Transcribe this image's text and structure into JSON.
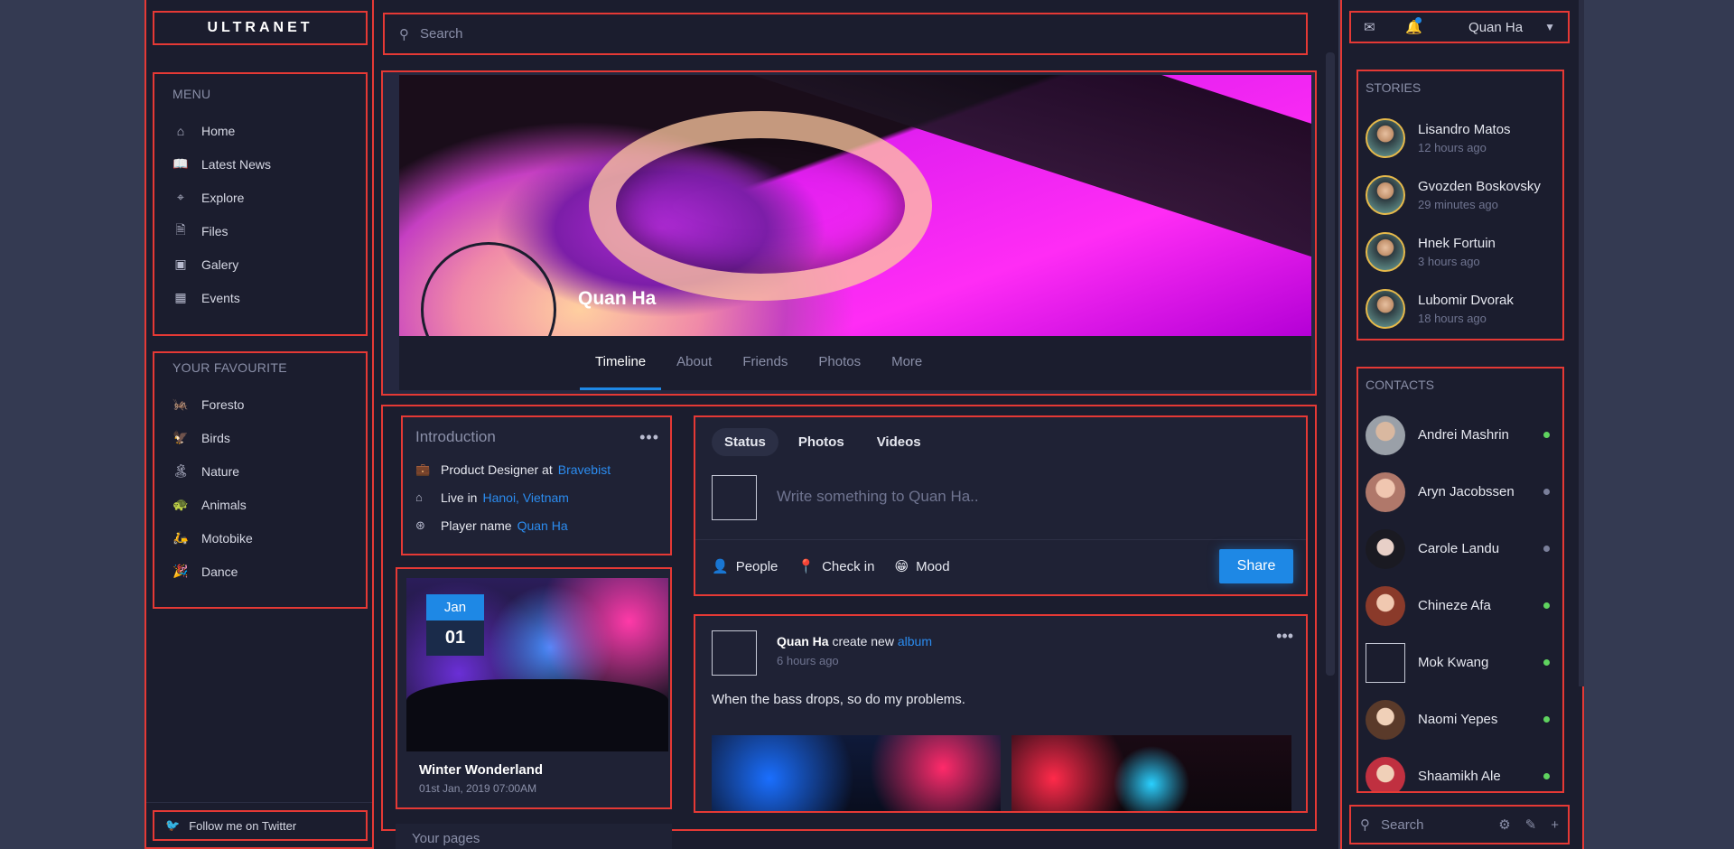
{
  "brand": "ULTRANET",
  "menu": {
    "heading": "MENU",
    "items": [
      {
        "label": "Home",
        "icon": "home-icon"
      },
      {
        "label": "Latest News",
        "icon": "book-icon"
      },
      {
        "label": "Explore",
        "icon": "map-pin-icon"
      },
      {
        "label": "Files",
        "icon": "file-icon"
      },
      {
        "label": "Galery",
        "icon": "image-icon"
      },
      {
        "label": "Events",
        "icon": "calendar-icon"
      }
    ]
  },
  "favourite": {
    "heading": "YOUR FAVOURITE",
    "items": [
      {
        "label": "Foresto",
        "icon": "🦗"
      },
      {
        "label": "Birds",
        "icon": "🦅"
      },
      {
        "label": "Nature",
        "icon": "🏝"
      },
      {
        "label": "Animals",
        "icon": "🐢"
      },
      {
        "label": "Motobike",
        "icon": "🛵"
      },
      {
        "label": "Dance",
        "icon": "🎉"
      }
    ]
  },
  "twitter": "Follow me on Twitter",
  "search": {
    "placeholder": "Search"
  },
  "profile": {
    "name": "Quan Ha",
    "tabs": [
      "Timeline",
      "About",
      "Friends",
      "Photos",
      "More"
    ],
    "active_tab": "Timeline"
  },
  "introduction": {
    "title": "Introduction",
    "rows": [
      {
        "label": "Product Designer at",
        "link": "Bravebist"
      },
      {
        "label": "Live in",
        "link": "Hanoi, Vietnam"
      },
      {
        "label": "Player name",
        "link": "Quan Ha"
      }
    ]
  },
  "event": {
    "month": "Jan",
    "day": "01",
    "title": "Winter Wonderland",
    "when": "01st Jan, 2019 07:00AM"
  },
  "your_pages": "Your pages",
  "composer": {
    "tabs": [
      "Status",
      "Photos",
      "Videos"
    ],
    "placeholder": "Write something to Quan Ha..",
    "actions": [
      {
        "label": "People",
        "icon": "👤"
      },
      {
        "label": "Check in",
        "icon": "📍"
      },
      {
        "label": "Mood",
        "icon": "😁"
      }
    ],
    "share": "Share"
  },
  "post": {
    "author": "Quan Ha",
    "action": "create new",
    "link": "album",
    "time": "6 hours ago",
    "text": "When the bass drops, so do my problems."
  },
  "user": {
    "name": "Quan Ha"
  },
  "stories": {
    "heading": "STORIES",
    "items": [
      {
        "name": "Lisandro Matos",
        "time": "12 hours ago"
      },
      {
        "name": "Gvozden Boskovsky",
        "time": "29 minutes ago"
      },
      {
        "name": "Hnek Fortuin",
        "time": "3 hours ago"
      },
      {
        "name": "Lubomir Dvorak",
        "time": "18 hours ago"
      }
    ]
  },
  "contacts": {
    "heading": "CONTACTS",
    "items": [
      {
        "name": "Andrei Mashrin",
        "status": "online"
      },
      {
        "name": "Aryn Jacobssen",
        "status": "offline"
      },
      {
        "name": "Carole Landu",
        "status": "offline"
      },
      {
        "name": "Chineze Afa",
        "status": "online"
      },
      {
        "name": "Mok Kwang",
        "status": "online"
      },
      {
        "name": "Naomi Yepes",
        "status": "online"
      },
      {
        "name": "Shaamikh Ale",
        "status": "online"
      }
    ]
  },
  "right_search": {
    "placeholder": "Search"
  },
  "colors": {
    "accent": "#1e88e5",
    "online": "#5fd35f",
    "offline": "#7a7f9a",
    "highlight_border": "#e53935"
  }
}
